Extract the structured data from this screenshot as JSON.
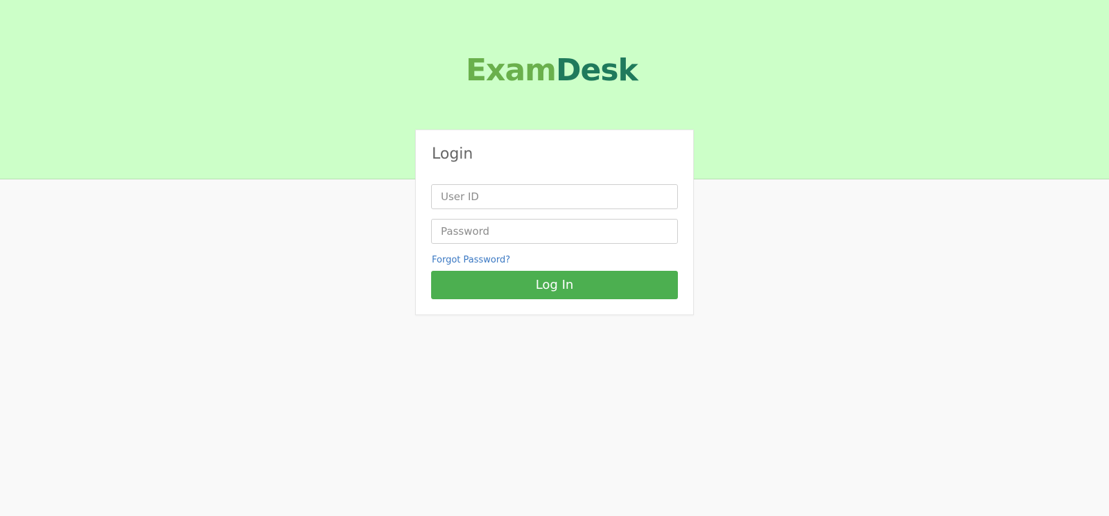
{
  "brand": {
    "name": "ExamDesk",
    "part1": "Exam",
    "part2": "Desk",
    "color_light": "#6ab04c",
    "color_dark": "#1f7a5c"
  },
  "login": {
    "title": "Login",
    "user_id_placeholder": "User ID",
    "user_id_value": "",
    "password_placeholder": "Password",
    "password_value": "",
    "forgot_password_label": "Forgot Password?",
    "submit_label": "Log In"
  },
  "colors": {
    "top_band": "#ccffc8",
    "page_background": "#f9f9f9",
    "button": "#4caf50",
    "link": "#3a78c3"
  }
}
